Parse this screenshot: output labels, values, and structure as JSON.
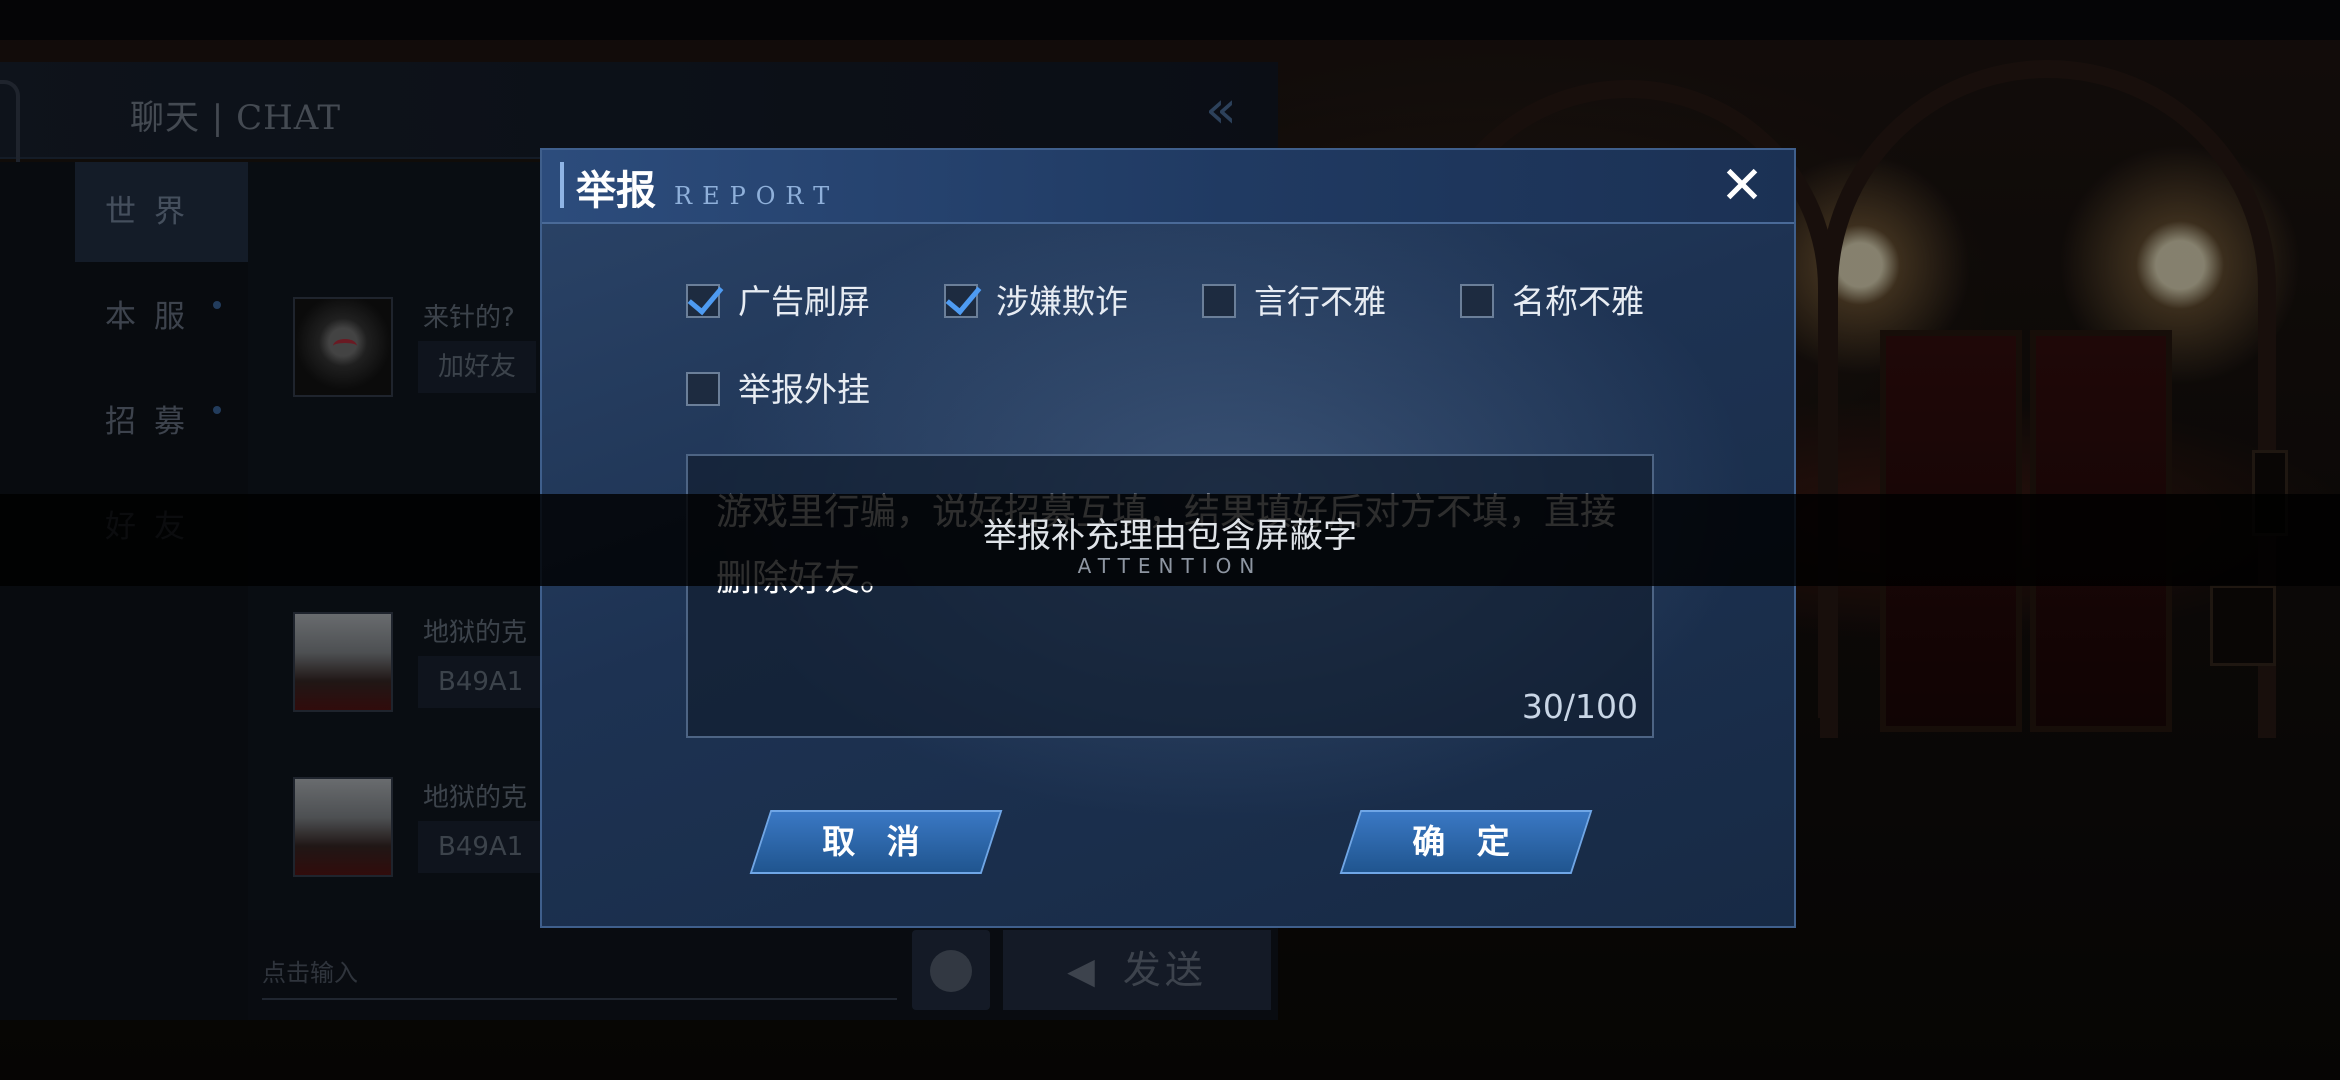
{
  "chat": {
    "title": "聊天 | CHAT",
    "nav": [
      {
        "label": "世界",
        "active": true,
        "dot": false
      },
      {
        "label": "本服",
        "active": false,
        "dot": true
      },
      {
        "label": "招募",
        "active": false,
        "dot": true
      },
      {
        "label": "好友",
        "active": false,
        "dot": false
      }
    ],
    "messages": [
      {
        "name": "来针的?",
        "text": "加好友",
        "avatar": "wolf-avatar"
      },
      {
        "name": "地狱的克",
        "text": "B49A1",
        "avatar": "white-hair-avatar"
      },
      {
        "name": "地狱的克",
        "text": "B49A1",
        "avatar": "white-hair-avatar"
      }
    ],
    "input_placeholder": "点击输入",
    "send_label": "发送"
  },
  "report_dialog": {
    "title": "举报",
    "subtitle": "REPORT",
    "options": [
      {
        "label": "广告刷屏",
        "checked": true
      },
      {
        "label": "涉嫌欺诈",
        "checked": true
      },
      {
        "label": "言行不雅",
        "checked": false
      },
      {
        "label": "名称不雅",
        "checked": false
      },
      {
        "label": "举报外挂",
        "checked": false
      }
    ],
    "reason_text": "游戏里行骗，说好招募互填，结果填好后对方不填，直接删除好友。",
    "counter": "30/100",
    "cancel_label": "取 消",
    "confirm_label": "确 定"
  },
  "toast": {
    "message": "举报补充理由包含屏蔽字",
    "sub": "ATTENTION"
  },
  "colors": {
    "accent": "#4e9bf2",
    "dialog_bg": "#1d3252",
    "button": "#2a66ad"
  }
}
